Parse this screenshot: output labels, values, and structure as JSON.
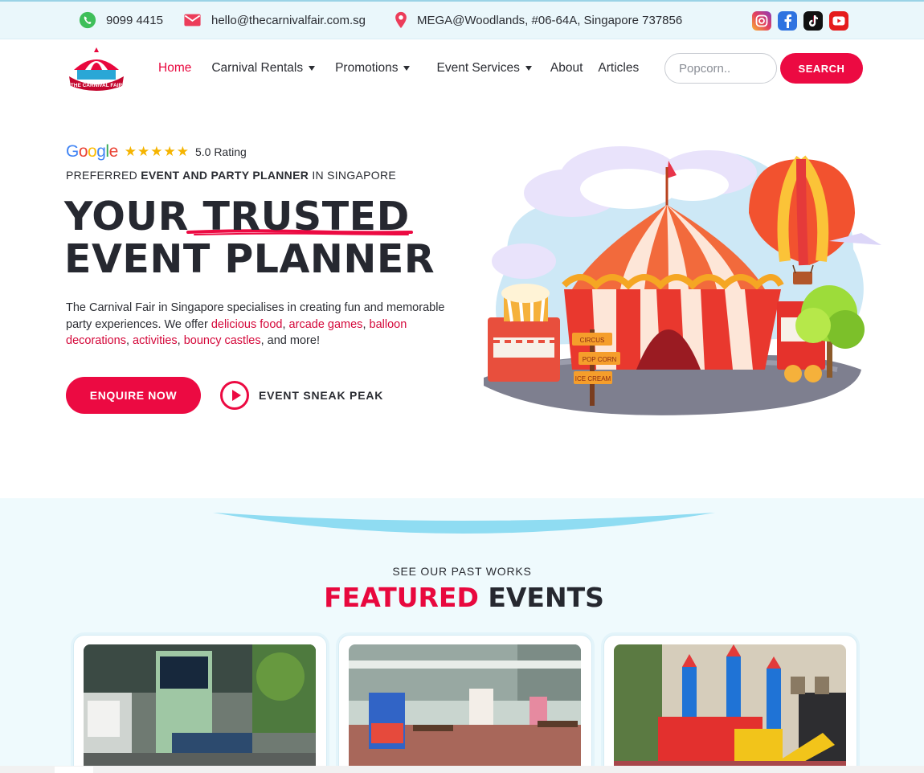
{
  "topbar": {
    "phone": "9099 4415",
    "email": "hello@thecarnivalfair.com.sg",
    "address": "MEGA@Woodlands,  #06-64A, Singapore 737856",
    "social": [
      "instagram-icon",
      "facebook-icon",
      "tiktok-icon",
      "youtube-icon"
    ]
  },
  "nav": {
    "logo_text": "THE CARNIVAL FAIR",
    "items": [
      {
        "label": "Home",
        "active": true,
        "dropdown": false
      },
      {
        "label": "Carnival Rentals",
        "active": false,
        "dropdown": true
      },
      {
        "label": "Promotions",
        "active": false,
        "dropdown": true
      },
      {
        "label": "Event Services",
        "active": false,
        "dropdown": true
      },
      {
        "label": "About",
        "active": false,
        "dropdown": false
      },
      {
        "label": "Articles",
        "active": false,
        "dropdown": false
      }
    ],
    "search_placeholder": "Popcorn..",
    "search_button": "SEARCH"
  },
  "hero": {
    "google": "Google",
    "stars": "★★★★★",
    "rating": "5.0 Rating",
    "kicker_pre": "PREFERRED ",
    "kicker_bold": "EVENT AND PARTY PLANNER",
    "kicker_post": " IN SINGAPORE",
    "headline_line1": "YOUR TRUSTED",
    "headline_line2": "EVENT PLANNER",
    "desc_pre": "The Carnival Fair in Singapore specialises in creating fun and memorable party experiences. We offer ",
    "desc_link1": "delicious food",
    "desc_sep1": ", ",
    "desc_link2": "arcade games",
    "desc_sep2": ", ",
    "desc_link3": "balloon decorations",
    "desc_sep3": ", ",
    "desc_link4": "activities",
    "desc_sep4": ", ",
    "desc_link5": "bouncy castles",
    "desc_post": ", and more!",
    "enquire": "ENQUIRE NOW",
    "sneak": "EVENT SNEAK PEAK",
    "sign_labels": [
      "CIRCUS",
      "POP CORN",
      "ICE CREAM"
    ]
  },
  "featured": {
    "kicker": "SEE OUR PAST WORKS",
    "title_red": "FEATURED",
    "title_rest": " EVENTS"
  },
  "colors": {
    "accent": "#ec0a42",
    "dark": "#262830",
    "section_bg": "#effafd",
    "wave": "#8fdcf2"
  }
}
